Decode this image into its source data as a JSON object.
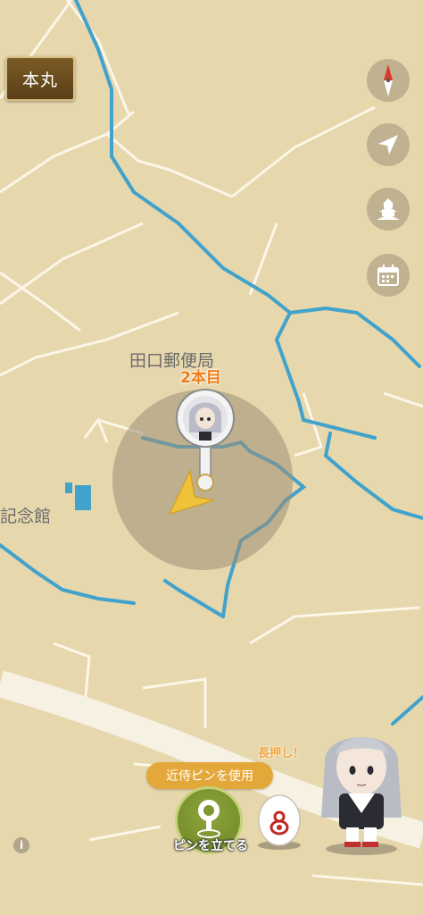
{
  "header": {
    "honmaru_label": "本丸"
  },
  "side_buttons": [
    {
      "name": "compass-icon"
    },
    {
      "name": "locate-arrow-icon"
    },
    {
      "name": "castle-icon"
    },
    {
      "name": "calendar-icon"
    }
  ],
  "map": {
    "labels": {
      "post_office": "田口郵便局",
      "memorial_hall": "記念館"
    },
    "pin": {
      "label": "2本目"
    }
  },
  "bottom": {
    "use_pin_label": "近侍ピンを使用",
    "place_pin_label": "ピンを立てる",
    "long_press_hint": "長押し！",
    "info_label": "i"
  },
  "colors": {
    "map_bg": "#e6d7ad",
    "river": "#41a2cc",
    "road": "#ffffff",
    "accent": "#f07a10"
  }
}
